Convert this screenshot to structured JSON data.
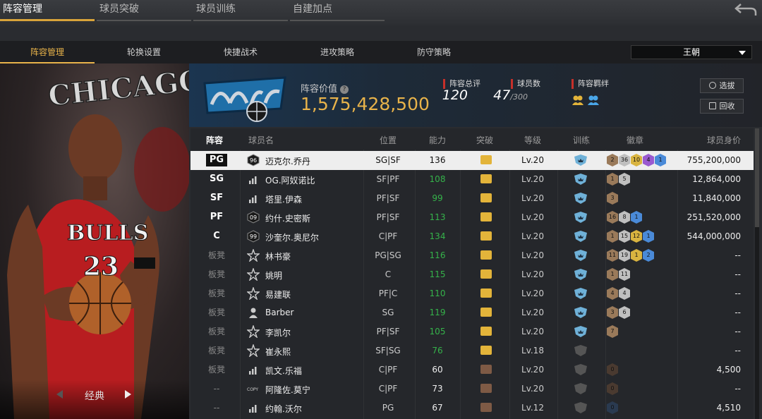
{
  "top_tabs": [
    {
      "label": "阵容管理",
      "active": true
    },
    {
      "label": "球员突破",
      "active": false
    },
    {
      "label": "球员训练",
      "active": false
    },
    {
      "label": "自建加点",
      "active": false
    }
  ],
  "sub_tabs": [
    {
      "label": "阵容管理",
      "active": true
    },
    {
      "label": "轮换设置",
      "active": false
    },
    {
      "label": "快捷战术",
      "active": false
    },
    {
      "label": "进攻策略",
      "active": false
    },
    {
      "label": "防守策略",
      "active": false
    }
  ],
  "team_select": {
    "value": "王朝"
  },
  "player_card": {
    "jersey_text": "BULLS",
    "jersey_number": "23",
    "backdrop_text": "CHICAGO BULLS",
    "card_type": "经典"
  },
  "team_header": {
    "lineup_value_label": "阵容价值",
    "lineup_value": "1,575,428,500",
    "rating_label": "阵容总评",
    "rating_value": "120",
    "count_label": "球员数",
    "count_value": "47",
    "count_max": "/300",
    "bond_label": "阵容羁绊",
    "draft_button": "选拔",
    "recall_button": "回收"
  },
  "table_headers": {
    "slot": "阵容",
    "name": "球员名",
    "position": "位置",
    "ability": "能力",
    "breakthrough": "突破",
    "level": "等级",
    "training": "训练",
    "badges": "徽章",
    "value": "球员身价"
  },
  "rows": [
    {
      "slot": "PG",
      "icon": "rank-96-icon",
      "icon_text": "96",
      "name": "迈克尔.乔丹",
      "position": "SG|SF",
      "ability": "136",
      "ability_color": "white",
      "break": "gold",
      "level": "Lv.20",
      "train": "blue",
      "badges": [
        [
          "2",
          "#9a7a5a"
        ],
        [
          "36",
          "#bfbfbf"
        ],
        [
          "10",
          "#d9b440"
        ],
        [
          "4",
          "#9a5ad0"
        ],
        [
          "1",
          "#4a8ad8"
        ]
      ],
      "value": "755,200,000",
      "selected": true
    },
    {
      "slot": "SG",
      "icon": "bars-icon",
      "name": "OG.阿奴诺比",
      "position": "SF|PF",
      "ability": "108",
      "ability_color": "green",
      "break": "gold",
      "level": "Lv.20",
      "train": "blue",
      "badges": [
        [
          "1",
          "#9a7a5a"
        ],
        [
          "5",
          "#bfbfbf"
        ]
      ],
      "value": "12,864,000"
    },
    {
      "slot": "SF",
      "icon": "bars-icon",
      "name": "塔里.伊森",
      "position": "PF|SF",
      "ability": "99",
      "ability_color": "green",
      "break": "gold",
      "level": "Lv.20",
      "train": "blue",
      "badges": [
        [
          "3",
          "#9a7a5a"
        ]
      ],
      "value": "11,840,000"
    },
    {
      "slot": "PF",
      "icon": "rank-09-icon",
      "icon_text": "09",
      "name": "约什.史密斯",
      "position": "PF|SF",
      "ability": "113",
      "ability_color": "green",
      "break": "gold",
      "level": "Lv.20",
      "train": "blue",
      "badges": [
        [
          "16",
          "#9a7a5a"
        ],
        [
          "8",
          "#bfbfbf"
        ],
        [
          "1",
          "#4a8ad8"
        ]
      ],
      "value": "251,520,000"
    },
    {
      "slot": "C",
      "icon": "rank-99-icon",
      "icon_text": "99",
      "name": "沙奎尔.奥尼尔",
      "position": "C|PF",
      "ability": "134",
      "ability_color": "green",
      "break": "gold",
      "level": "Lv.20",
      "train": "blue",
      "badges": [
        [
          "1",
          "#9a7a5a"
        ],
        [
          "15",
          "#bfbfbf"
        ],
        [
          "12",
          "#d9b440"
        ],
        [
          "1",
          "#4a8ad8"
        ]
      ],
      "value": "544,000,000"
    },
    {
      "slot": "板凳",
      "icon": "star-icon",
      "name": "林书豪",
      "position": "PG|SG",
      "ability": "116",
      "ability_color": "green",
      "break": "gold",
      "level": "Lv.20",
      "train": "blue",
      "badges": [
        [
          "11",
          "#9a7a5a"
        ],
        [
          "19",
          "#bfbfbf"
        ],
        [
          "1",
          "#d9b440"
        ],
        [
          "2",
          "#4a8ad8"
        ]
      ],
      "value": "--"
    },
    {
      "slot": "板凳",
      "icon": "star-icon",
      "name": "姚明",
      "position": "C",
      "ability": "115",
      "ability_color": "green",
      "break": "gold",
      "level": "Lv.20",
      "train": "blue",
      "badges": [
        [
          "1",
          "#9a7a5a"
        ],
        [
          "11",
          "#bfbfbf"
        ]
      ],
      "value": "--"
    },
    {
      "slot": "板凳",
      "icon": "star-icon",
      "name": "易建联",
      "position": "PF|C",
      "ability": "110",
      "ability_color": "green",
      "break": "gold",
      "level": "Lv.20",
      "train": "blue",
      "badges": [
        [
          "4",
          "#9a7a5a"
        ],
        [
          "4",
          "#bfbfbf"
        ]
      ],
      "value": "--"
    },
    {
      "slot": "板凳",
      "icon": "person-icon",
      "name": "Barber",
      "position": "SG",
      "ability": "119",
      "ability_color": "green",
      "break": "gold",
      "level": "Lv.20",
      "train": "blue",
      "badges": [
        [
          "3",
          "#9a7a5a"
        ],
        [
          "6",
          "#bfbfbf"
        ]
      ],
      "value": "--"
    },
    {
      "slot": "板凳",
      "icon": "star-icon",
      "name": "李凯尔",
      "position": "PF|SF",
      "ability": "105",
      "ability_color": "green",
      "break": "gold",
      "level": "Lv.20",
      "train": "blue",
      "badges": [
        [
          "7",
          "#9a7a5a"
        ]
      ],
      "value": "--"
    },
    {
      "slot": "板凳",
      "icon": "star-icon",
      "name": "崔永熙",
      "position": "SF|SG",
      "ability": "76",
      "ability_color": "green",
      "break": "gold",
      "level": "Lv.18",
      "train": "gray",
      "badges": [],
      "value": "--"
    },
    {
      "slot": "板凳",
      "icon": "bars-icon",
      "name": "凯文.乐福",
      "position": "C|PF",
      "ability": "60",
      "ability_color": "white",
      "break": "brown",
      "level": "Lv.20",
      "train": "gray",
      "badges": [
        [
          "0",
          "#4a3a30"
        ]
      ],
      "value": "4,500"
    },
    {
      "slot": "--",
      "icon": "copy-icon",
      "icon_text": "COPY",
      "name": "阿隆佐.莫宁",
      "position": "C|PF",
      "ability": "73",
      "ability_color": "white",
      "break": "brown",
      "level": "Lv.20",
      "train": "gray",
      "badges": [
        [
          "0",
          "#4a3a30"
        ]
      ],
      "value": "--"
    },
    {
      "slot": "--",
      "icon": "bars-icon",
      "name": "约翰.沃尔",
      "position": "PG",
      "ability": "67",
      "ability_color": "white",
      "break": "brown",
      "level": "Lv.12",
      "train": "gray",
      "badges": [
        [
          "0",
          "#2a3a50"
        ]
      ],
      "value": "4,510"
    }
  ]
}
